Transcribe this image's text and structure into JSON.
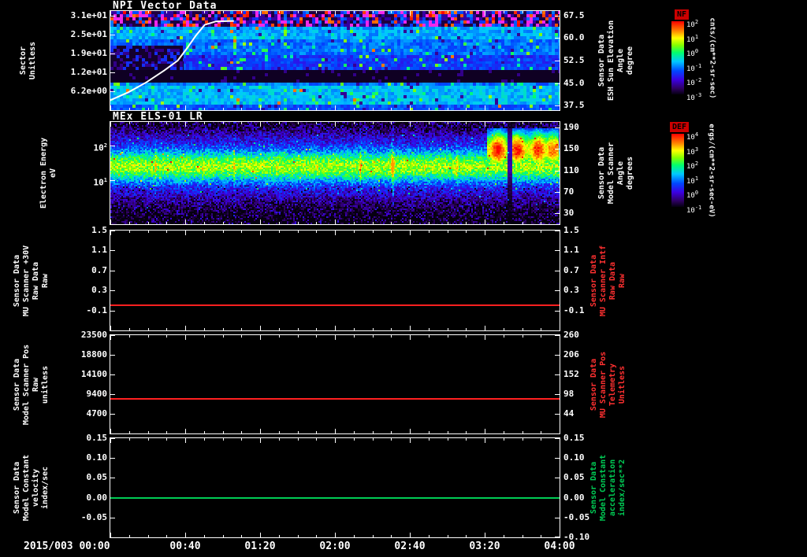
{
  "x_axis": {
    "date_label": "2015/003",
    "tick_labels": [
      "00:00",
      "00:40",
      "01:20",
      "02:00",
      "02:40",
      "03:20",
      "04:00"
    ]
  },
  "chart_data": [
    {
      "type": "heatmap",
      "title": "NPI Vector Data",
      "left_axis": {
        "label": "Sector\nUnitless",
        "scale": "linear",
        "lim": [
          0,
          32.5
        ],
        "ticks": [
          {
            "v": 31,
            "label": "3.1e+01"
          },
          {
            "v": 24.8,
            "label": "2.5e+01"
          },
          {
            "v": 18.6,
            "label": "1.9e+01"
          },
          {
            "v": 12.4,
            "label": "1.2e+01"
          },
          {
            "v": 6.2,
            "label": "6.2e+00"
          }
        ]
      },
      "right_axis": {
        "label": "Sensor Data\nESH Sun Elevation\nAngle\ndegree",
        "scale": "linear",
        "lim": [
          36,
          69
        ],
        "ticks": [
          {
            "v": 67.5,
            "label": "67.5"
          },
          {
            "v": 60,
            "label": "60.0"
          },
          {
            "v": 52.5,
            "label": "52.5"
          },
          {
            "v": 45,
            "label": "45.0"
          },
          {
            "v": 37.5,
            "label": "37.5"
          }
        ]
      },
      "colorbar": {
        "title": "NF",
        "units": "cnts/(cm**2-sr-sec)",
        "tick_exps": [
          2,
          1,
          0,
          -1,
          -2,
          -3
        ]
      },
      "overlay_line": {
        "name": "ESH Sun Elevation Angle",
        "color": "#ffffff",
        "points_frac": [
          [
            0,
            0.9
          ],
          [
            0.04,
            0.82
          ],
          [
            0.08,
            0.72
          ],
          [
            0.12,
            0.6
          ],
          [
            0.15,
            0.5
          ],
          [
            0.17,
            0.38
          ],
          [
            0.19,
            0.25
          ],
          [
            0.21,
            0.14
          ],
          [
            0.235,
            0.105
          ],
          [
            0.275,
            0.1
          ]
        ]
      },
      "texture": "npi"
    },
    {
      "type": "heatmap",
      "title": "MEx ELS-01 LR",
      "left_axis": {
        "label": "Electron Energy\neV",
        "scale": "log",
        "lim": [
          0.5,
          500
        ],
        "ticks": [
          {
            "v": 100,
            "label": "10^2"
          },
          {
            "v": 10,
            "label": "10^1"
          }
        ]
      },
      "right_axis": {
        "label": "Sensor Data\nModel Scanner\nAngle\ndegrees",
        "scale": "linear",
        "lim": [
          10,
          200
        ],
        "ticks": [
          {
            "v": 190,
            "label": "190"
          },
          {
            "v": 150,
            "label": "150"
          },
          {
            "v": 110,
            "label": "110"
          },
          {
            "v": 70,
            "label": "70"
          },
          {
            "v": 30,
            "label": "30"
          }
        ]
      },
      "colorbar": {
        "title": "DEF",
        "units": "ergs/(cm**2-sr-sec-eV)",
        "tick_exps": [
          4,
          3,
          2,
          1,
          0,
          -1
        ]
      },
      "texture": "els"
    },
    {
      "type": "line",
      "left_axis": {
        "label": "Sensor Data\nMU Scanner +30V\nRaw Data\nRaw",
        "scale": "linear",
        "lim": [
          -0.5,
          1.5
        ],
        "ticks": [
          {
            "v": 1.5,
            "label": "1.5"
          },
          {
            "v": 1.1,
            "label": "1.1"
          },
          {
            "v": 0.7,
            "label": "0.7"
          },
          {
            "v": 0.3,
            "label": "0.3"
          },
          {
            "v": -0.1,
            "label": "-0.1"
          }
        ]
      },
      "right_axis": {
        "label": "Sensor Data\nMU Scanner Intf\nRaw Data\nRaw",
        "label_color": "#ff3030",
        "scale": "linear",
        "lim": [
          -0.5,
          1.5
        ],
        "ticks": [
          {
            "v": 1.5,
            "label": "1.5"
          },
          {
            "v": 1.1,
            "label": "1.1"
          },
          {
            "v": 0.7,
            "label": "0.7"
          },
          {
            "v": 0.3,
            "label": "0.3"
          },
          {
            "v": -0.1,
            "label": "-0.1"
          }
        ]
      },
      "series": [
        {
          "name": "MU Scanner +30V Raw Data",
          "color": "#ff2020",
          "constant_value": 0.0
        }
      ]
    },
    {
      "type": "line",
      "left_axis": {
        "label": "Sensor Data\nModel Scanner Pos\nRaw\nunitless",
        "scale": "linear",
        "lim": [
          0,
          23500
        ],
        "ticks": [
          {
            "v": 23500,
            "label": "23500"
          },
          {
            "v": 18800,
            "label": "18800"
          },
          {
            "v": 14100,
            "label": "14100"
          },
          {
            "v": 9400,
            "label": "9400"
          },
          {
            "v": 4700,
            "label": "4700"
          }
        ]
      },
      "right_axis": {
        "label": "Sensor Data\nMU Scanner Pos\nTelemetry\nUnitless",
        "label_color": "#ff3030",
        "scale": "linear",
        "lim": [
          -10,
          260
        ],
        "ticks": [
          {
            "v": 260,
            "label": "260"
          },
          {
            "v": 206,
            "label": "206"
          },
          {
            "v": 152,
            "label": "152"
          },
          {
            "v": 98,
            "label": "98"
          },
          {
            "v": 44,
            "label": "44"
          }
        ]
      },
      "series": [
        {
          "name": "Model Scanner Pos Raw",
          "color": "#ff2020",
          "constant_value": 8200
        }
      ]
    },
    {
      "type": "line",
      "left_axis": {
        "label": "Sensor Data\nModel Constant\nvelocity\nindex/sec",
        "scale": "linear",
        "lim": [
          -0.1,
          0.15
        ],
        "ticks": [
          {
            "v": 0.15,
            "label": "0.15"
          },
          {
            "v": 0.1,
            "label": "0.10"
          },
          {
            "v": 0.05,
            "label": "0.05"
          },
          {
            "v": 0,
            "label": "0.00"
          },
          {
            "v": -0.05,
            "label": "-0.05"
          }
        ]
      },
      "right_axis": {
        "label": "Sensor Data\nModel Constant\nacceleration\nindex/sec**2",
        "label_color": "#00cc55",
        "scale": "linear",
        "lim": [
          -0.1,
          0.15
        ],
        "ticks": [
          {
            "v": 0.15,
            "label": "0.15"
          },
          {
            "v": 0.1,
            "label": "0.10"
          },
          {
            "v": 0.05,
            "label": "0.05"
          },
          {
            "v": 0,
            "label": "0.00"
          },
          {
            "v": -0.05,
            "label": "-0.05"
          },
          {
            "v": -0.1,
            "label": "-0.10"
          }
        ]
      },
      "series": [
        {
          "name": "Model Constant velocity",
          "color": "#00cc55",
          "constant_value": 0.0
        }
      ]
    }
  ]
}
